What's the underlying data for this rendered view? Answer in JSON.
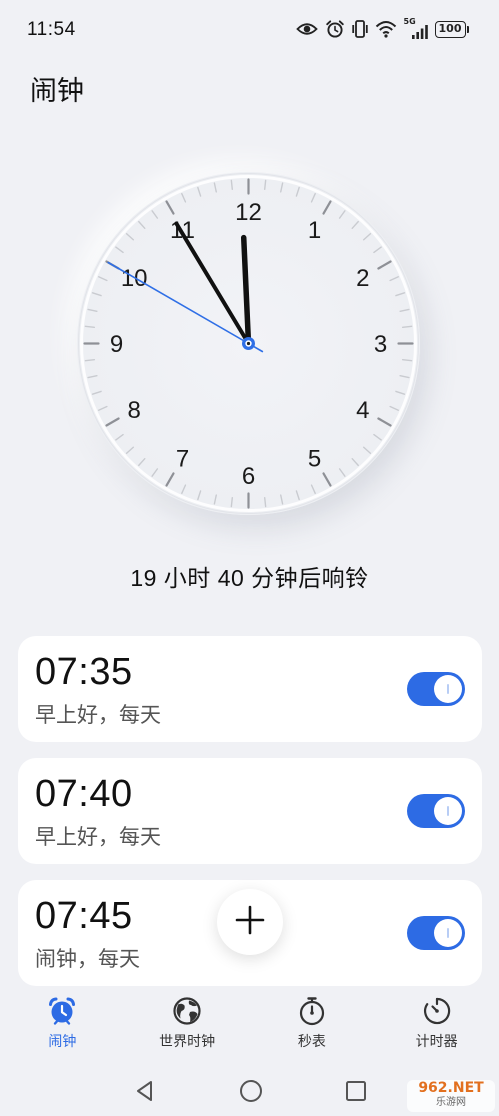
{
  "status_bar": {
    "time": "11:54",
    "icons": [
      "eye-icon",
      "alarm-icon",
      "vibrate-icon",
      "wifi-icon",
      "signal-icon",
      "battery-icon"
    ],
    "network": "5G",
    "battery": "100"
  },
  "header": {
    "title": "闹钟"
  },
  "analog_clock": {
    "numerals": [
      "12",
      "1",
      "2",
      "3",
      "4",
      "5",
      "6",
      "7",
      "8",
      "9",
      "10",
      "11"
    ],
    "time": {
      "hour": 11,
      "minute": 54,
      "second": 50
    }
  },
  "next_alarm": {
    "countdown": "19 小时 40 分钟后响铃"
  },
  "alarms": [
    {
      "time": "07:35",
      "label": "早上好，每天",
      "enabled": true
    },
    {
      "time": "07:40",
      "label": "早上好，每天",
      "enabled": true
    },
    {
      "time": "07:45",
      "label": "闹钟，每天",
      "enabled": true
    }
  ],
  "fab": {
    "icon": "plus-icon"
  },
  "bottom_nav": {
    "items": [
      {
        "label": "闹钟",
        "icon": "alarm-clock-icon",
        "active": true
      },
      {
        "label": "世界时钟",
        "icon": "globe-clock-icon",
        "active": false
      },
      {
        "label": "秒表",
        "icon": "stopwatch-icon",
        "active": false
      },
      {
        "label": "计时器",
        "icon": "timer-icon",
        "active": false
      }
    ]
  },
  "system_nav": {
    "icons": [
      "back-icon",
      "home-icon",
      "recents-icon"
    ]
  },
  "watermark": {
    "text": "962.NET",
    "subtext": "乐游网"
  },
  "colors": {
    "accent": "#2d6be4",
    "second_hand": "#2f6fe6",
    "background": "#f0f1f5",
    "card": "#ffffff",
    "text": "#111111",
    "secondary_text": "#555555"
  }
}
